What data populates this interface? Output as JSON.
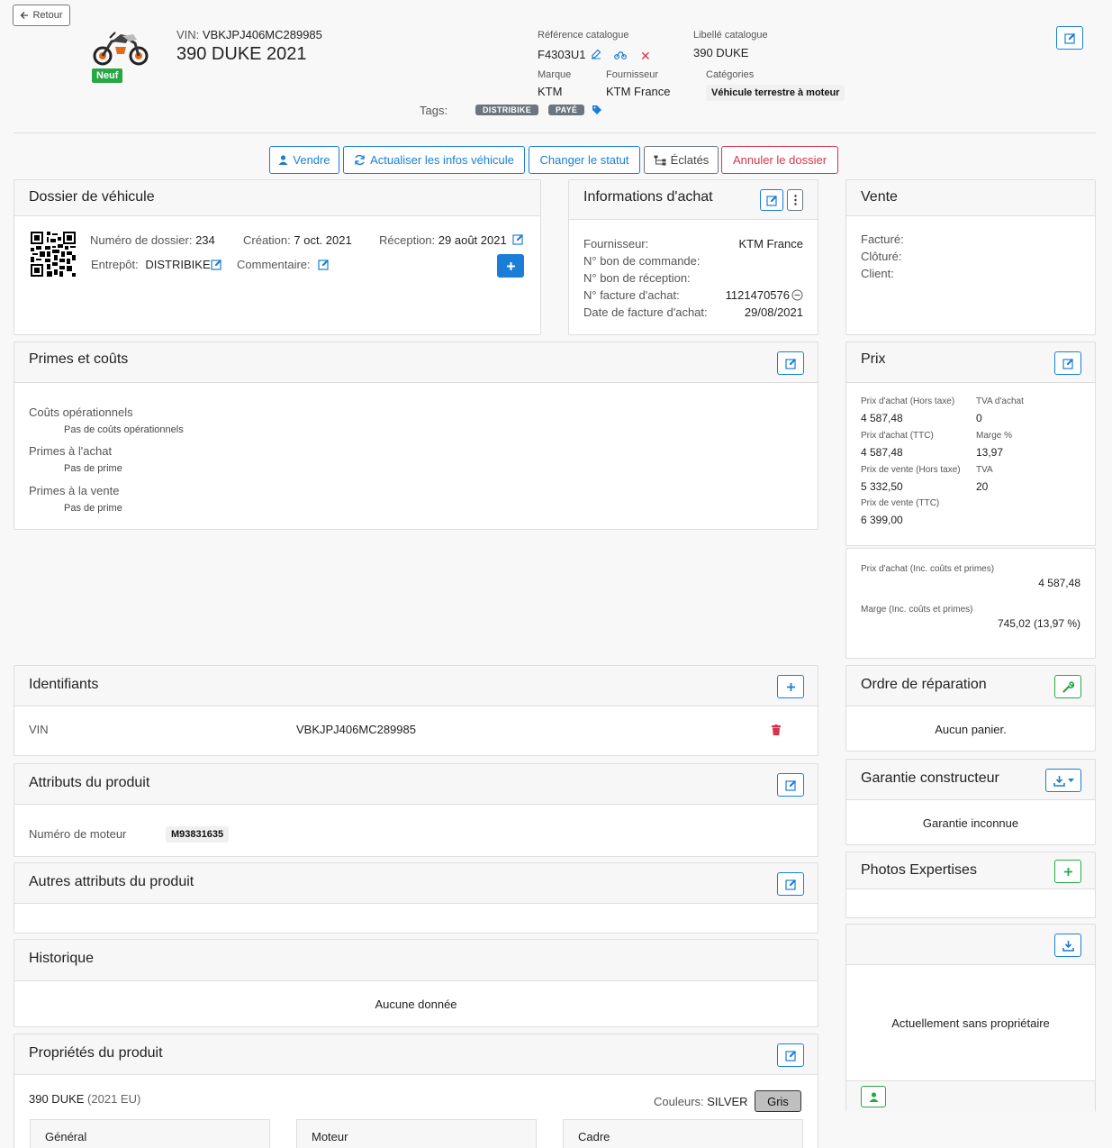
{
  "header": {
    "back_label": "Retour",
    "badge": "Neuf",
    "vin_label": "VIN:",
    "vin": "VBKJPJ406MC289985",
    "title": "390 DUKE 2021",
    "ref_label": "Référence catalogue",
    "ref_value": "F4303U1",
    "libelle_label": "Libellé catalogue",
    "libelle_value": "390 DUKE",
    "marque_label": "Marque",
    "marque_value": "KTM",
    "fournisseur_label": "Fournisseur",
    "fournisseur_value": "KTM France",
    "categories_label": "Catégories",
    "category": "Véhicule terrestre à moteur",
    "tags_label": "Tags:",
    "tags": [
      "DISTRIBIKE",
      "PAYÉ"
    ]
  },
  "actions": {
    "vendre": "Vendre",
    "actualiser": "Actualiser les infos véhicule",
    "changer": "Changer le statut",
    "eclates": "Éclatés",
    "annuler": "Annuler le dossier"
  },
  "dossier": {
    "title": "Dossier de véhicule",
    "numero_label": "Numéro de dossier:",
    "numero": "234",
    "creation_label": "Création:",
    "creation": "7 oct. 2021",
    "reception_label": "Réception:",
    "reception": "29 août 2021",
    "entrepot_label": "Entrepôt:",
    "entrepot": "DISTRIBIKE",
    "commentaire_label": "Commentaire:"
  },
  "achat": {
    "title": "Informations d'achat",
    "rows": [
      {
        "label": "Fournisseur:",
        "value": "KTM France"
      },
      {
        "label": "N° bon de commande:",
        "value": ""
      },
      {
        "label": "N° bon de réception:",
        "value": ""
      },
      {
        "label": "N° facture d'achat:",
        "value": "1121470576"
      },
      {
        "label": "Date de facture d'achat:",
        "value": "29/08/2021"
      }
    ]
  },
  "vente": {
    "title": "Vente",
    "rows": [
      "Facturé:",
      "Clôturé:",
      "Client:"
    ]
  },
  "primes": {
    "title": "Primes et coûts",
    "sections": [
      {
        "label": "Coûts opérationnels",
        "empty": "Pas de coûts opérationnels"
      },
      {
        "label": "Primes à l'achat",
        "empty": "Pas de prime"
      },
      {
        "label": "Primes à la vente",
        "empty": "Pas de prime"
      }
    ]
  },
  "prix": {
    "title": "Prix",
    "achat_ht_label": "Prix d'achat (Hors taxe)",
    "achat_ht": "4 587,48",
    "tva_achat_label": "TVA d'achat",
    "tva_achat": "0",
    "achat_ttc_label": "Prix d'achat (TTC)",
    "achat_ttc": "4 587,48",
    "marge_label": "Marge %",
    "marge": "13,97",
    "vente_ht_label": "Prix de vente (Hors taxe)",
    "vente_ht": "5 332,50",
    "tva_label": "TVA",
    "tva": "20",
    "vente_ttc_label": "Prix de vente (TTC)",
    "vente_ttc": "6 399,00",
    "achat_inc_label": "Prix d'achat (Inc. coûts et primes)",
    "achat_inc": "4 587,48",
    "marge_inc_label": "Marge (Inc. coûts et primes)",
    "marge_inc": "745,02 (13,97 %)"
  },
  "identifiants": {
    "title": "Identifiants",
    "label": "VIN",
    "value": "VBKJPJ406MC289985"
  },
  "ordre": {
    "title": "Ordre de réparation",
    "empty": "Aucun panier."
  },
  "attributs": {
    "title": "Attributs du produit",
    "label": "Numéro de moteur",
    "value": "M93831635"
  },
  "garantie": {
    "title": "Garantie constructeur",
    "empty": "Garantie inconnue"
  },
  "autres": {
    "title": "Autres attributs du produit"
  },
  "photos": {
    "title": "Photos Expertises"
  },
  "historique": {
    "title": "Historique",
    "empty": "Aucune donnée"
  },
  "proprietaire": {
    "empty": "Actuellement sans propriétaire"
  },
  "proprietes": {
    "title": "Propriétés du produit",
    "model": "390 DUKE",
    "model_sub": "(2021 EU)",
    "couleurs_label": "Couleurs:",
    "couleur": "SILVER",
    "couleur_btn": "Gris",
    "tabs": [
      "Général",
      "Moteur",
      "Cadre"
    ]
  },
  "colors": {
    "accent": "#1a7ed8",
    "danger": "#d9334a",
    "success": "#28a745"
  }
}
